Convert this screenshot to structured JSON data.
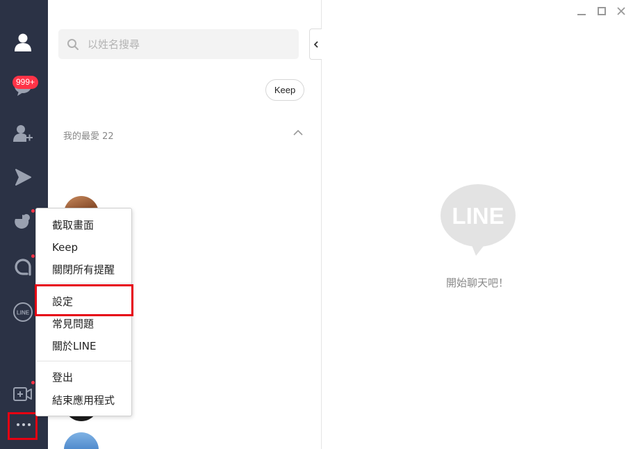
{
  "sidebar": {
    "items": [
      {
        "icon": "friends-icon"
      },
      {
        "icon": "chats-icon",
        "badge": "999+"
      },
      {
        "icon": "add-friend-icon"
      },
      {
        "icon": "line-voom-icon"
      },
      {
        "icon": "openchat-icon"
      },
      {
        "icon": "square-icon"
      },
      {
        "icon": "line-service-icon",
        "label": "LINE"
      },
      {
        "icon": "video-call-icon"
      },
      {
        "icon": "more-icon"
      }
    ]
  },
  "search": {
    "placeholder": "以姓名搜尋"
  },
  "keep_chip": "Keep",
  "favorites": {
    "label": "我的最愛 22"
  },
  "chat": {
    "logo_text": "LINE",
    "empty_text": "開始聊天吧！"
  },
  "menu": {
    "items": [
      "截取畫面",
      "Keep",
      "關閉所有提醒",
      "設定",
      "常見問題",
      "關於LINE",
      "登出",
      "結束應用程式"
    ]
  },
  "colors": {
    "rail_bg": "#2b3245",
    "badge_bg": "#ff3347",
    "highlight": "#e60012",
    "logo_gray": "#e3e3e3"
  }
}
